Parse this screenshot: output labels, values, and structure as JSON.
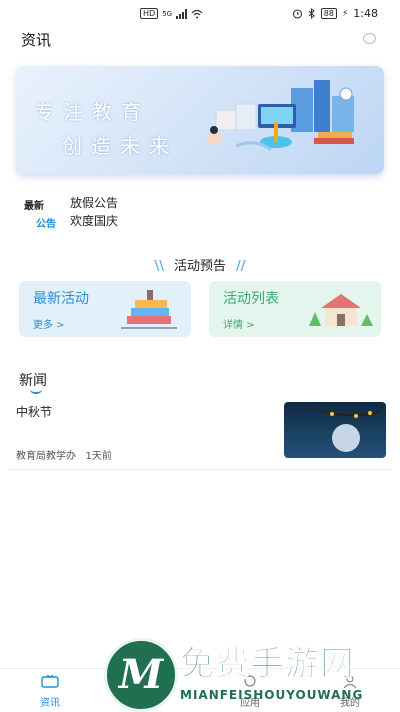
{
  "status_bar": {
    "hd_label": "HD",
    "network_label": "5G",
    "battery_level": "88",
    "time": "1:48"
  },
  "header": {
    "title": "资讯",
    "message_icon": "chat-bubble-icon"
  },
  "banner": {
    "line1": "专注教育",
    "line2": "创造未来"
  },
  "notice": {
    "badge_top": "最新",
    "badge_bottom": "公告",
    "items": [
      "放假公告",
      "欢度国庆"
    ]
  },
  "activity_preview": {
    "title": "活动预告",
    "cards": [
      {
        "title": "最新活动",
        "more": "更多 >"
      },
      {
        "title": "活动列表",
        "more": "详情 >"
      }
    ]
  },
  "news": {
    "heading": "新闻",
    "items": [
      {
        "title": "中秋节",
        "source": "教育局教学办",
        "time": "1天前"
      }
    ]
  },
  "tabbar": {
    "items": [
      {
        "label": "资讯",
        "icon": "tv-icon",
        "active": true
      },
      {
        "label": "交流",
        "icon": "chat-icon",
        "active": false
      },
      {
        "label": "应用",
        "icon": "apps-icon",
        "active": false
      },
      {
        "label": "我的",
        "icon": "user-icon",
        "active": false
      }
    ]
  },
  "watermark": {
    "cn": "免费手游网",
    "en": "MIANFEISHOUYOUWANG",
    "logo_letter": "M"
  },
  "colors": {
    "accent": "#1a8fd8",
    "green_accent": "#3aa97a",
    "watermark": "#1f6f50"
  }
}
